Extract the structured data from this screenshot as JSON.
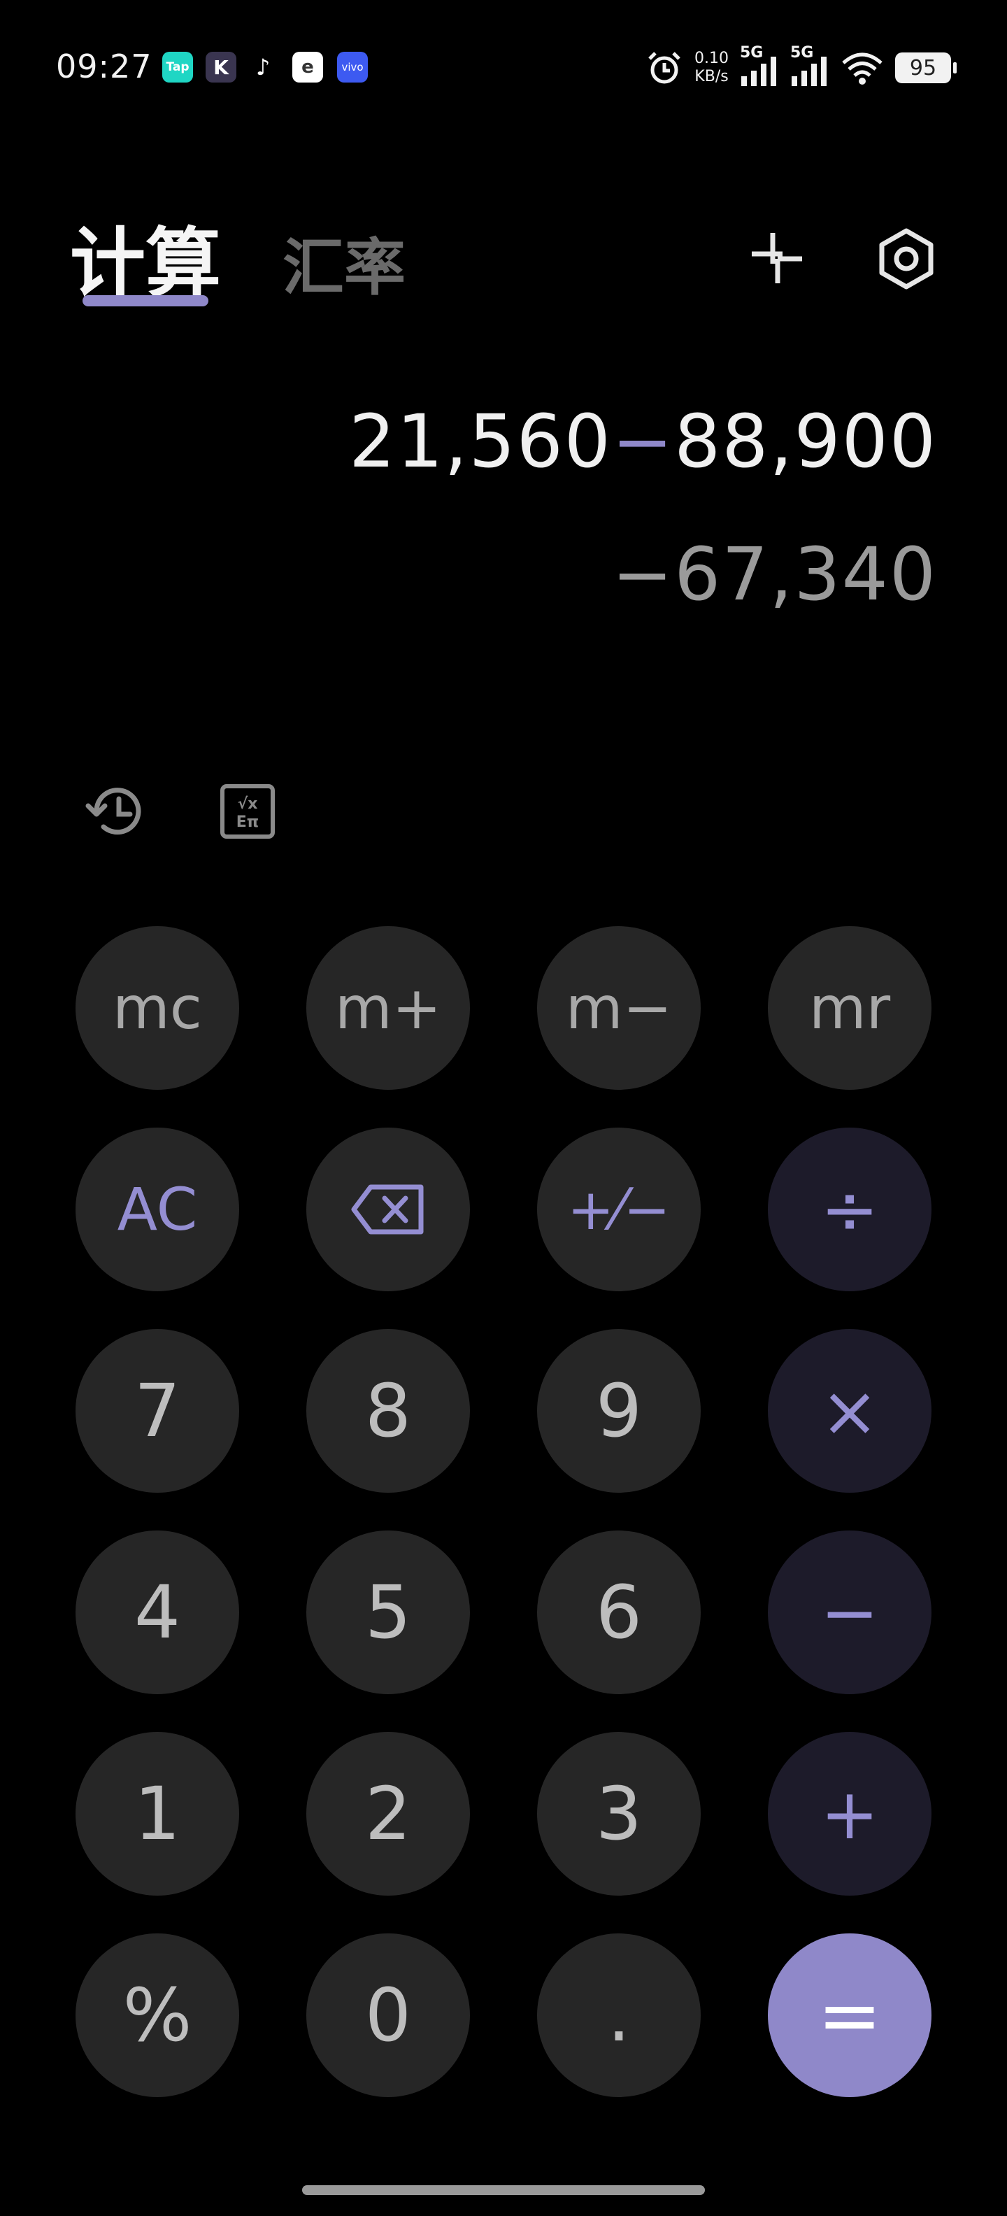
{
  "status_bar": {
    "time": "09:27",
    "apps": [
      {
        "name": "tap-app-icon",
        "label": "Tap",
        "bg": "#1fd6c4",
        "fg": "#ffffff"
      },
      {
        "name": "k-app-icon",
        "label": "K",
        "bg": "#3a3550",
        "fg": "#ffffff"
      },
      {
        "name": "tiktok-icon",
        "label": "♪",
        "bg": "#000000",
        "fg": "#ffffff"
      },
      {
        "name": "e-app-icon",
        "label": "e",
        "bg": "#ffffff",
        "fg": "#333333"
      },
      {
        "name": "vivo-app-icon",
        "label": "vivo",
        "bg": "#3d5af1",
        "fg": "#ffffff"
      }
    ],
    "net_speed_value": "0.10",
    "net_speed_unit": "KB/s",
    "signal1_label": "5G",
    "signal2_label": "5G",
    "battery": "95"
  },
  "header": {
    "tab_calculator": "计算",
    "tab_exchange": "汇率"
  },
  "display": {
    "operand1": "21,560",
    "operator": "−",
    "operand2": "88,900",
    "result": "−67,340"
  },
  "keypad": {
    "mc": "mc",
    "m_plus": "m+",
    "m_minus": "m−",
    "mr": "mr",
    "ac": "AC",
    "plus_minus": "+⁄−",
    "divide": "÷",
    "seven": "7",
    "eight": "8",
    "nine": "9",
    "multiply": "×",
    "four": "4",
    "five": "5",
    "six": "6",
    "minus": "−",
    "one": "1",
    "two": "2",
    "three": "3",
    "plus": "+",
    "percent": "%",
    "zero": "0",
    "dot": ".",
    "equals": "="
  },
  "colors": {
    "accent": "#8f88c9",
    "key_bg": "#262626",
    "operator_key_bg": "#1d1b2a",
    "background": "#000000"
  },
  "icons": {
    "collapse": "collapse-icon",
    "settings": "gear-icon",
    "history": "history-icon",
    "scientific": "scientific-icon",
    "backspace": "backspace-icon"
  }
}
